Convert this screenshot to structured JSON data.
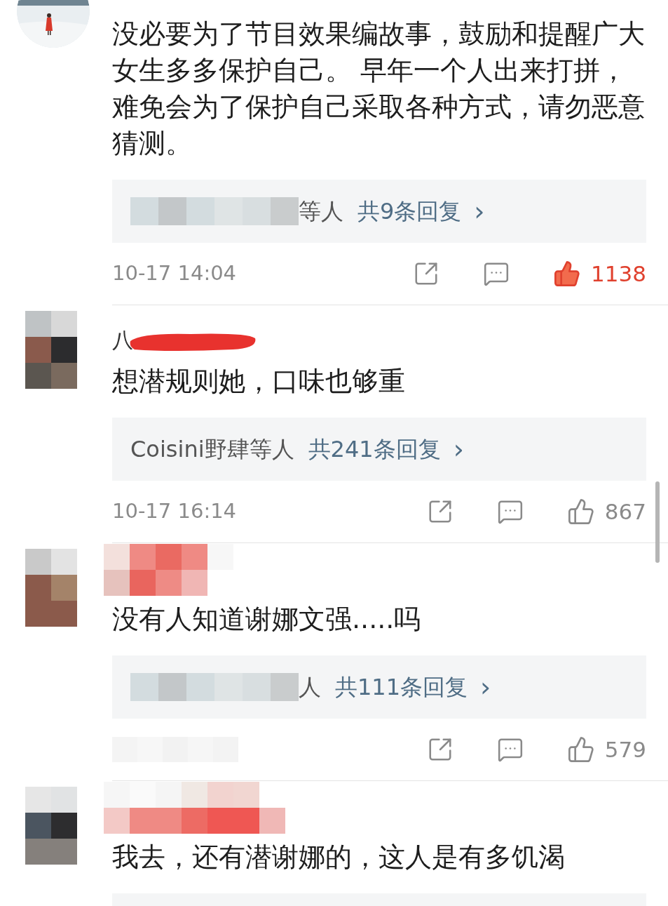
{
  "comments": [
    {
      "avatar_pixelated": false,
      "body": "没必要为了节目效果编故事，鼓励和提醒广大女生多多保护自己。 早年一个人出来打拼，难免会为了保护自己采取各种方式，请勿恶意猜测。",
      "replies": {
        "names": "等人",
        "names_redacted": true,
        "count": "共9条回复",
        "chevron": "›"
      },
      "time": "10-17 14:04",
      "liked": true,
      "likes": "1138"
    },
    {
      "avatar_pixelated": true,
      "name": "八",
      "name_scribbled": true,
      "body": "想潜规则她，口味也够重",
      "replies": {
        "names": "Coisini野肆等人",
        "names_redacted": false,
        "count": "共241条回复",
        "chevron": "›"
      },
      "time": "10-17 16:14",
      "liked": false,
      "likes": "867"
    },
    {
      "avatar_pixelated": true,
      "name_pixelated": true,
      "body": "没有人知道谢娜文强.....吗",
      "replies": {
        "names": "人",
        "names_redacted": true,
        "count": "共111条回复",
        "chevron": "›"
      },
      "liked": false,
      "likes": "579"
    },
    {
      "avatar_pixelated": true,
      "name_pixelated": true,
      "body": "我去，还有潜谢娜的，这人是有多饥渴",
      "more": true
    }
  ]
}
